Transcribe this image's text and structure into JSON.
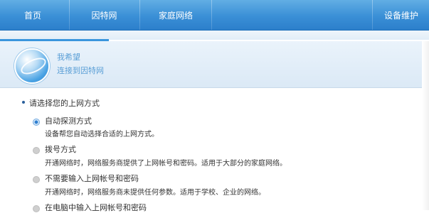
{
  "nav": {
    "items": [
      {
        "label": "首页"
      },
      {
        "label": "因特网"
      },
      {
        "label": "家庭网络"
      },
      {
        "label": "设备维护"
      }
    ]
  },
  "header": {
    "line1": "我希望",
    "line2": "连接到因特网"
  },
  "section_title": "请选择您的上网方式",
  "options": [
    {
      "label": "自动探测方式",
      "desc": "设备帮您自动选择合适的上网方式。",
      "selected": true
    },
    {
      "label": "拨号方式",
      "desc": "开通网络时，网络服务商提供了上网帐号和密码。适用于大部分的家庭网络。",
      "selected": false
    },
    {
      "label": "不需要输入上网帐号和密码",
      "desc": "开通网络时，网络服务商未提供任何参数。适用于学校、企业的网络。",
      "selected": false
    },
    {
      "label": "在电脑中输入上网帐号和密码",
      "desc": "",
      "selected": false
    }
  ],
  "colors": {
    "nav_bg": "#3a8fd6",
    "accent": "#2f7fd0",
    "header_text": "#5a9fd6"
  },
  "icons": [
    "globe-icon"
  ]
}
